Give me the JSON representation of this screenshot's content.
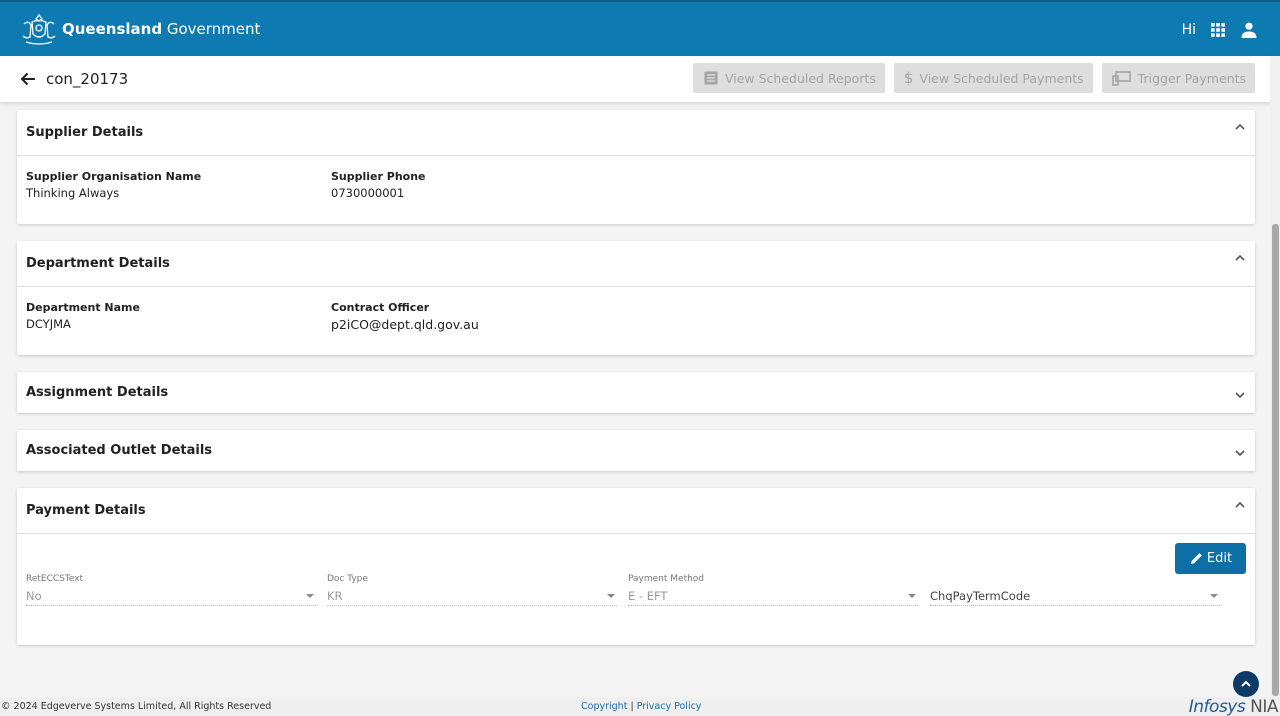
{
  "header": {
    "brand_bold": "Queensland",
    "brand_light": "Government",
    "greeting": "Hi"
  },
  "subheader": {
    "title": "con_20173",
    "actions": [
      {
        "label": "View Scheduled Reports",
        "icon": "report-icon"
      },
      {
        "label": "View Scheduled Payments",
        "icon": "dollar-icon"
      },
      {
        "label": "Trigger Payments",
        "icon": "devices-icon"
      }
    ]
  },
  "supplier": {
    "title": "Supplier Details",
    "org_label": "Supplier Organisation Name",
    "org_value": "Thinking Always",
    "phone_label": "Supplier Phone",
    "phone_value": "0730000001"
  },
  "department": {
    "title": "Department Details",
    "name_label": "Department Name",
    "name_value": "DCYJMA",
    "officer_label": "Contract Officer",
    "officer_value": "p2iCO@dept.qld.gov.au"
  },
  "assignment": {
    "title": "Assignment Details"
  },
  "outlet": {
    "title": "Associated Outlet Details"
  },
  "payment": {
    "title": "Payment Details",
    "edit_label": "Edit",
    "fields": [
      {
        "label": "RetECCSText",
        "value": "No"
      },
      {
        "label": "Doc Type",
        "value": "KR"
      },
      {
        "label": "Payment Method",
        "value": "E - EFT"
      },
      {
        "label": "",
        "value": "ChqPayTermCode"
      }
    ]
  },
  "footer": {
    "copyright": "© 2024 Edgeverve Systems Limited, All Rights Reserved",
    "link_copyright": "Copyright",
    "separator": "|",
    "link_privacy": "Privacy Policy",
    "brand_main": "Infosys",
    "brand_suffix": "NIA"
  },
  "colors": {
    "topbar": "#0d7ab1",
    "edit_button": "#0d6fa6",
    "scroll_top": "#0d3b66"
  }
}
